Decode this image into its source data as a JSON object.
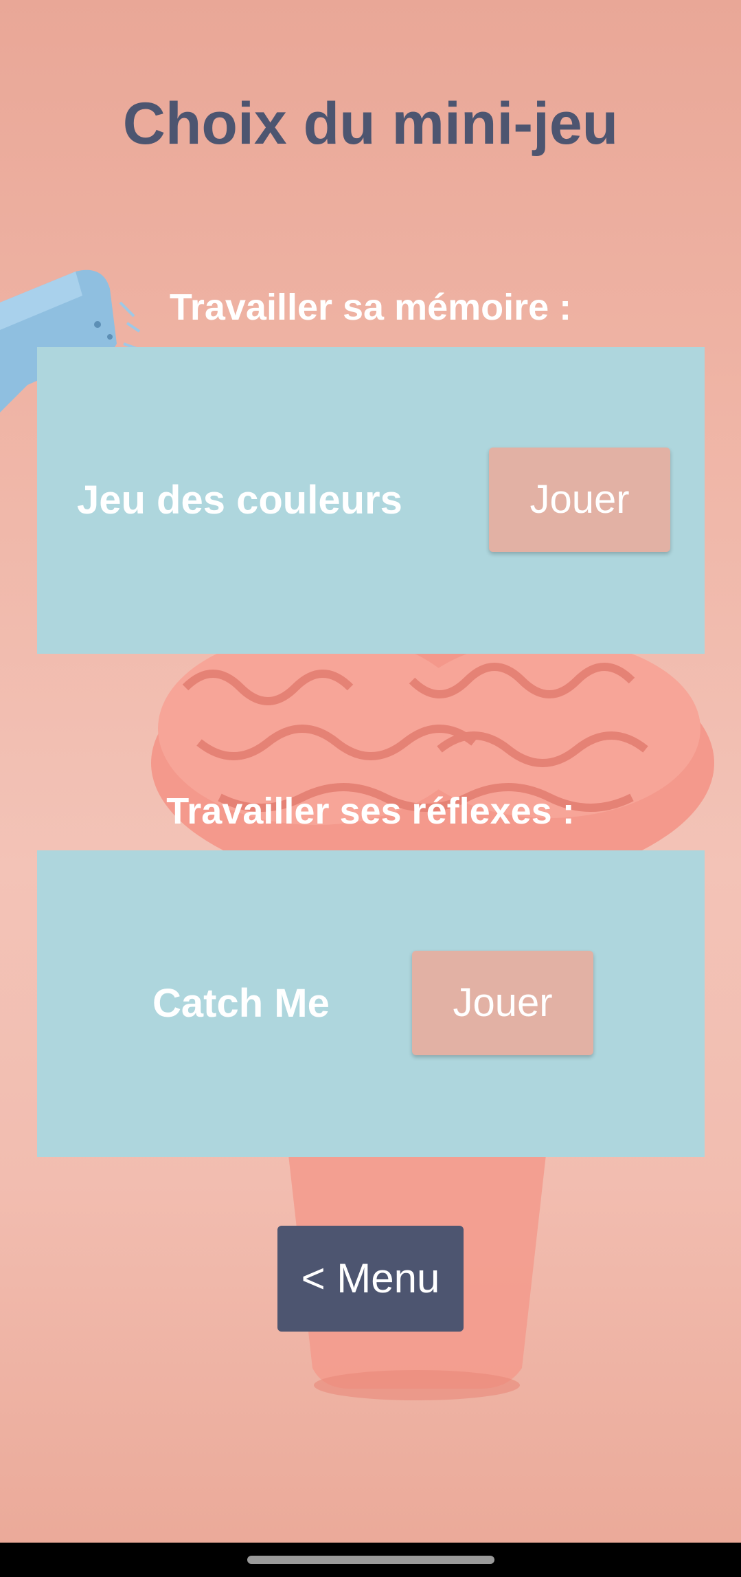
{
  "page": {
    "title": "Choix du mini-jeu"
  },
  "sections": [
    {
      "label": "Travailler sa mémoire :",
      "game_name": "Jeu des couleurs",
      "play_label": "Jouer"
    },
    {
      "label": "Travailler ses réflexes :",
      "game_name": "Catch Me",
      "play_label": "Jouer"
    }
  ],
  "footer": {
    "menu_label": "< Menu"
  },
  "colors": {
    "title": "#4d5570",
    "card": "#aed6dd",
    "play_button": "#e2b1a4",
    "menu_button": "#4d5570",
    "background": "#f2bdb0"
  },
  "icons": {
    "background_illustration": "brain-plant-pot-watering-can"
  }
}
